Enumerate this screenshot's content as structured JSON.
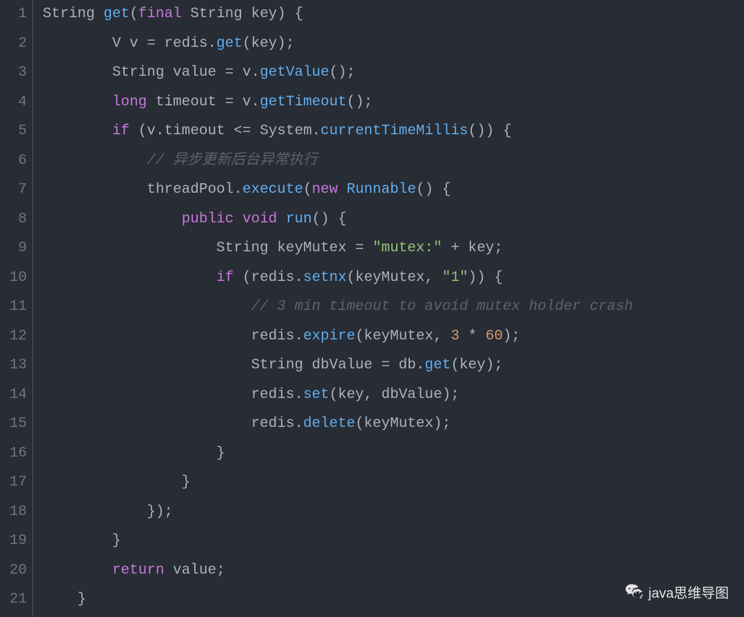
{
  "watermark": {
    "label": "java思维导图"
  },
  "code": {
    "lines": [
      {
        "num": "1",
        "tokens": [
          {
            "t": "String ",
            "c": "type"
          },
          {
            "t": "get",
            "c": "method"
          },
          {
            "t": "(",
            "c": "punct"
          },
          {
            "t": "final",
            "c": "keyword"
          },
          {
            "t": " String key",
            "c": "type"
          },
          {
            "t": ")",
            "c": "punct"
          },
          {
            "t": " {",
            "c": "punct"
          }
        ]
      },
      {
        "num": "2",
        "tokens": [
          {
            "t": "        V v = redis.",
            "c": "ident"
          },
          {
            "t": "get",
            "c": "method"
          },
          {
            "t": "(key);",
            "c": "punct"
          }
        ]
      },
      {
        "num": "3",
        "tokens": [
          {
            "t": "        String value = v.",
            "c": "ident"
          },
          {
            "t": "getValue",
            "c": "method"
          },
          {
            "t": "();",
            "c": "punct"
          }
        ]
      },
      {
        "num": "4",
        "tokens": [
          {
            "t": "        ",
            "c": "ident"
          },
          {
            "t": "long",
            "c": "keyword"
          },
          {
            "t": " timeout = v.",
            "c": "ident"
          },
          {
            "t": "getTimeout",
            "c": "method"
          },
          {
            "t": "();",
            "c": "punct"
          }
        ]
      },
      {
        "num": "5",
        "tokens": [
          {
            "t": "        ",
            "c": "ident"
          },
          {
            "t": "if",
            "c": "keyword"
          },
          {
            "t": " (v.timeout <= System.",
            "c": "ident"
          },
          {
            "t": "currentTimeMillis",
            "c": "method"
          },
          {
            "t": "()) {",
            "c": "punct"
          }
        ]
      },
      {
        "num": "6",
        "tokens": [
          {
            "t": "            ",
            "c": "ident"
          },
          {
            "t": "// 异步更新后台异常执行",
            "c": "comment"
          }
        ]
      },
      {
        "num": "7",
        "tokens": [
          {
            "t": "            threadPool.",
            "c": "ident"
          },
          {
            "t": "execute",
            "c": "method"
          },
          {
            "t": "(",
            "c": "punct"
          },
          {
            "t": "new",
            "c": "keyword"
          },
          {
            "t": " ",
            "c": "ident"
          },
          {
            "t": "Runnable",
            "c": "method"
          },
          {
            "t": "() {",
            "c": "punct"
          }
        ]
      },
      {
        "num": "8",
        "tokens": [
          {
            "t": "                ",
            "c": "ident"
          },
          {
            "t": "public",
            "c": "keyword"
          },
          {
            "t": " ",
            "c": "ident"
          },
          {
            "t": "void",
            "c": "keyword"
          },
          {
            "t": " ",
            "c": "ident"
          },
          {
            "t": "run",
            "c": "method"
          },
          {
            "t": "() {",
            "c": "punct"
          }
        ]
      },
      {
        "num": "9",
        "tokens": [
          {
            "t": "                    String keyMutex = ",
            "c": "ident"
          },
          {
            "t": "\"mutex:\"",
            "c": "string"
          },
          {
            "t": " + key;",
            "c": "ident"
          }
        ]
      },
      {
        "num": "10",
        "tokens": [
          {
            "t": "                    ",
            "c": "ident"
          },
          {
            "t": "if",
            "c": "keyword"
          },
          {
            "t": " (redis.",
            "c": "ident"
          },
          {
            "t": "setnx",
            "c": "method"
          },
          {
            "t": "(keyMutex, ",
            "c": "ident"
          },
          {
            "t": "\"1\"",
            "c": "string"
          },
          {
            "t": ")) {",
            "c": "punct"
          }
        ]
      },
      {
        "num": "11",
        "tokens": [
          {
            "t": "                        ",
            "c": "ident"
          },
          {
            "t": "// 3 min timeout to avoid mutex holder crash",
            "c": "comment"
          }
        ]
      },
      {
        "num": "12",
        "tokens": [
          {
            "t": "                        redis.",
            "c": "ident"
          },
          {
            "t": "expire",
            "c": "method"
          },
          {
            "t": "(keyMutex, ",
            "c": "ident"
          },
          {
            "t": "3",
            "c": "number"
          },
          {
            "t": " * ",
            "c": "ident"
          },
          {
            "t": "60",
            "c": "number"
          },
          {
            "t": ");",
            "c": "punct"
          }
        ]
      },
      {
        "num": "13",
        "tokens": [
          {
            "t": "                        String dbValue = db.",
            "c": "ident"
          },
          {
            "t": "get",
            "c": "method"
          },
          {
            "t": "(key);",
            "c": "punct"
          }
        ]
      },
      {
        "num": "14",
        "tokens": [
          {
            "t": "                        redis.",
            "c": "ident"
          },
          {
            "t": "set",
            "c": "method"
          },
          {
            "t": "(key, dbValue);",
            "c": "punct"
          }
        ]
      },
      {
        "num": "15",
        "tokens": [
          {
            "t": "                        redis.",
            "c": "ident"
          },
          {
            "t": "delete",
            "c": "method"
          },
          {
            "t": "(keyMutex);",
            "c": "punct"
          }
        ]
      },
      {
        "num": "16",
        "tokens": [
          {
            "t": "                    }",
            "c": "punct"
          }
        ]
      },
      {
        "num": "17",
        "tokens": [
          {
            "t": "                }",
            "c": "punct"
          }
        ]
      },
      {
        "num": "18",
        "tokens": [
          {
            "t": "            });",
            "c": "punct"
          }
        ]
      },
      {
        "num": "19",
        "tokens": [
          {
            "t": "        }",
            "c": "punct"
          }
        ]
      },
      {
        "num": "20",
        "tokens": [
          {
            "t": "        ",
            "c": "ident"
          },
          {
            "t": "return",
            "c": "keyword"
          },
          {
            "t": " value;",
            "c": "ident"
          }
        ]
      },
      {
        "num": "21",
        "tokens": [
          {
            "t": "    }",
            "c": "punct"
          }
        ]
      }
    ]
  }
}
